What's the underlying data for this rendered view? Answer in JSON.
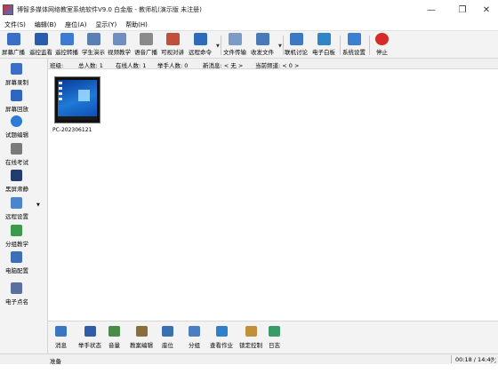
{
  "window": {
    "title": "博智多媒体网络教室系统软件V9.0 白金版 - 教师机(演示版 未注册)",
    "minimize": "—",
    "maximize": "❐",
    "close": "✕"
  },
  "menu": [
    "文件(S)",
    "编辑(B)",
    "座位(A)",
    "显示(Y)",
    "帮助(H)"
  ],
  "toolbar": [
    {
      "label": "屏幕广播",
      "color": "#3b6fc7"
    },
    {
      "label": "遥控监看",
      "color": "#2a5cad"
    },
    {
      "label": "遥控转播",
      "color": "#3d7bd1"
    },
    {
      "label": "学生演示",
      "color": "#5b7fb4"
    },
    {
      "label": "视频教学",
      "color": "#6e8fc0"
    },
    {
      "label": "语音广播",
      "color": "#8a8a8a"
    },
    {
      "label": "可视对讲",
      "color": "#c0503a"
    },
    {
      "label": "远程命令",
      "color": "#2f6bb8"
    },
    {
      "label": "文件传输",
      "color": "#7a9cc6"
    },
    {
      "label": "收发文件",
      "color": "#4a79b8"
    },
    {
      "label": "联机讨论",
      "color": "#3f78c2"
    },
    {
      "label": "电子白板",
      "color": "#2e86c8"
    },
    {
      "label": "系统设置",
      "color": "#3a7fd0"
    },
    {
      "label": "停止",
      "color": "#d62b2b"
    }
  ],
  "sidebar": [
    {
      "label": "屏幕录制",
      "color": "#3b6fc7"
    },
    {
      "label": "屏幕回放",
      "color": "#2f66c0"
    },
    {
      "label": "试题编辑",
      "color": "#2d7bd6"
    },
    {
      "label": "在线考试",
      "color": "#7a7a7a"
    },
    {
      "label": "黑屏肃静",
      "color": "#233c6e"
    },
    {
      "label": "远程设置",
      "color": "#4a86cc"
    },
    {
      "label": "分组教学",
      "color": "#3b9b4a"
    },
    {
      "label": "电脑配置",
      "color": "#3c6fb6"
    },
    {
      "label": "电子点名",
      "color": "#5a6fa0"
    }
  ],
  "stats": {
    "group": "班级:",
    "total": "总人数: 1",
    "online": "在线人数: 1",
    "hands": "举手人数: 0",
    "message": "新消息: < 无 >",
    "channel": "当前频道: < 0 >"
  },
  "students": [
    {
      "name": "PC-202306121"
    }
  ],
  "bottombar": [
    {
      "label": "消息",
      "color": "#3a76c4"
    },
    {
      "label": "举手状态",
      "color": "#2f5da8"
    },
    {
      "label": "音量",
      "color": "#4a8b4a"
    },
    {
      "label": "教案编辑",
      "color": "#8a6f3a"
    },
    {
      "label": "座位",
      "color": "#3a6fb0"
    },
    {
      "label": "分组",
      "color": "#4a7ec0"
    },
    {
      "label": "查看作业",
      "color": "#2e80c9"
    },
    {
      "label": "锁定控制",
      "color": "#c0913a"
    },
    {
      "label": "日志",
      "color": "#3a9a6a"
    }
  ],
  "status": {
    "left": "准备",
    "right": "00:18 / 14:43"
  }
}
